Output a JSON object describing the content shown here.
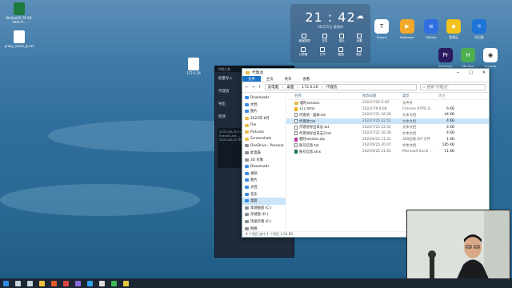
{
  "desktop": {
    "icons": [
      {
        "label": "file2aa59-79 58-4edc-9...",
        "icon": "excel-icon",
        "color": "#1f7a3e"
      },
      {
        "label": "proxy_socks_ip.txt",
        "icon": "text-file-icon",
        "color": "#ffffff"
      },
      {
        "label": "172.0.26",
        "icon": "text-file-icon",
        "color": "#ffffff"
      }
    ]
  },
  "widget": {
    "time": "21 : 42",
    "date": "06月25日",
    "weekday": "星期四",
    "weather_icon": "cloud-icon",
    "quick": [
      "桌面整理",
      "文件",
      "图片",
      "设置",
      "计算器",
      "打开",
      "截图",
      "更多"
    ]
  },
  "apps": [
    {
      "label": "Typora",
      "color": "#ffffff",
      "glyph": "T"
    },
    {
      "label": "Potplayer",
      "color": "#f2a82a",
      "glyph": "▶"
    },
    {
      "label": "ToDesk",
      "color": "#2f6fe0",
      "glyph": "≡"
    },
    {
      "label": "坚果云",
      "color": "#f4c21c",
      "glyph": "◆"
    },
    {
      "label": "向日葵",
      "color": "#1d73d8",
      "glyph": "☼"
    },
    {
      "label": "Premiere",
      "color": "#2a1a5e",
      "glyph": "Pr"
    },
    {
      "label": "HBuilder",
      "color": "#4caf50",
      "glyph": "H"
    },
    {
      "label": "Chrome",
      "color": "#ffffff",
      "glyph": "◉"
    }
  ],
  "side_panel": {
    "title": "代理工具",
    "rows": [
      "批量导入",
      "代理池",
      "导出",
      "检测"
    ],
    "log": [
      "2022-06-25 21:42 开始检测...",
      "Extra01.txt ... OK",
      "2022-06-25 完成"
    ]
  },
  "explorer": {
    "title": "代理池",
    "ribbon": [
      "文件",
      "主页",
      "共享",
      "查看"
    ],
    "path": [
      "此电脑",
      "桌面",
      "172.0.26",
      "代理池"
    ],
    "search_placeholder": "搜索\"代理池\"",
    "nav": [
      {
        "label": "Downloads",
        "icon": "download-folder-icon"
      },
      {
        "label": "文档",
        "icon": "document-folder-icon"
      },
      {
        "label": "图片",
        "icon": "picture-folder-icon"
      },
      {
        "label": "2022年-8月",
        "icon": "folder-icon"
      },
      {
        "label": "File",
        "icon": "folder-icon"
      },
      {
        "label": "Pictures",
        "icon": "folder-icon"
      },
      {
        "label": "Screenshots",
        "icon": "folder-icon"
      },
      {
        "label": "OneDrive - Persona",
        "icon": "cloud-icon"
      },
      {
        "label": "此电脑",
        "icon": "computer-icon"
      },
      {
        "label": "3D 对象",
        "icon": "cube-icon"
      },
      {
        "label": "Downloads",
        "icon": "download-folder-icon"
      },
      {
        "label": "视频",
        "icon": "video-folder-icon"
      },
      {
        "label": "图片",
        "icon": "picture-folder-icon"
      },
      {
        "label": "文档",
        "icon": "document-folder-icon"
      },
      {
        "label": "音乐",
        "icon": "music-folder-icon"
      },
      {
        "label": "桌面",
        "icon": "desktop-folder-icon"
      },
      {
        "label": "本地磁盘 (C:)",
        "icon": "drive-icon"
      },
      {
        "label": "存储盘 (D:)",
        "icon": "drive-icon"
      },
      {
        "label": "快速存储 (E:)",
        "icon": "drive-icon"
      },
      {
        "label": "网络",
        "icon": "network-icon"
      }
    ],
    "headers": [
      "名称",
      "修改日期",
      "类型",
      "大小"
    ],
    "files": [
      {
        "name": "临时session",
        "date": "2022/7/26 5:49",
        "type": "文件夹",
        "size": "",
        "icon": "folder-icon"
      },
      {
        "name": "111.html",
        "date": "2022/7/8 8:08",
        "type": "Chrome HTML D...",
        "size": "6 KB",
        "icon": "html-icon"
      },
      {
        "name": "代理池 - 副本.txt",
        "date": "2022/7/21 16:28",
        "type": "文本文档",
        "size": "44 KB",
        "icon": "text-file-icon"
      },
      {
        "name": "代理池.txt",
        "date": "2022/7/25 22:52",
        "type": "文本文档",
        "size": "4 KB",
        "icon": "text-file-icon"
      },
      {
        "name": "代理池导出日志.txt",
        "date": "2022/7/25 22:54",
        "type": "文本文档",
        "size": "4 KB",
        "icon": "text-file-icon"
      },
      {
        "name": "代理池导出日志2.txt",
        "date": "2022/7/21 16:28",
        "type": "文本文档",
        "size": "4 KB",
        "icon": "text-file-icon"
      },
      {
        "name": "临时session.zip",
        "date": "2022/6/25 21:21",
        "type": "360压缩 ZIP 文件",
        "size": "1 KB",
        "icon": "zip-icon"
      },
      {
        "name": "账号信息.txt",
        "date": "2022/6/25 20:47",
        "type": "文本文档",
        "size": "185 KB",
        "icon": "text-file-icon"
      },
      {
        "name": "账号信息.xlsx",
        "date": "2022/6/25 21:03",
        "type": "Microsoft Excel ...",
        "size": "11 KB",
        "icon": "excel-icon"
      }
    ],
    "status": "9 个项目   选中 1 个项目 3.54 KB"
  },
  "taskbar": {
    "items": [
      {
        "name": "start-button",
        "color": "#2b8be6"
      },
      {
        "name": "search-button",
        "color": "#c8d2dc"
      },
      {
        "name": "task-view-button",
        "color": "#c8d2dc"
      },
      {
        "name": "explorer-button",
        "color": "#f0c040"
      },
      {
        "name": "app-button",
        "color": "#e05a2a"
      },
      {
        "name": "app-button",
        "color": "#d44"
      },
      {
        "name": "app-button",
        "color": "#8a6ae0"
      },
      {
        "name": "app-button",
        "color": "#2fa0ee"
      },
      {
        "name": "app-button",
        "color": "#e0e0e0"
      },
      {
        "name": "app-button",
        "color": "#3dbb55"
      },
      {
        "name": "app-button",
        "color": "#e8c83a"
      }
    ]
  }
}
